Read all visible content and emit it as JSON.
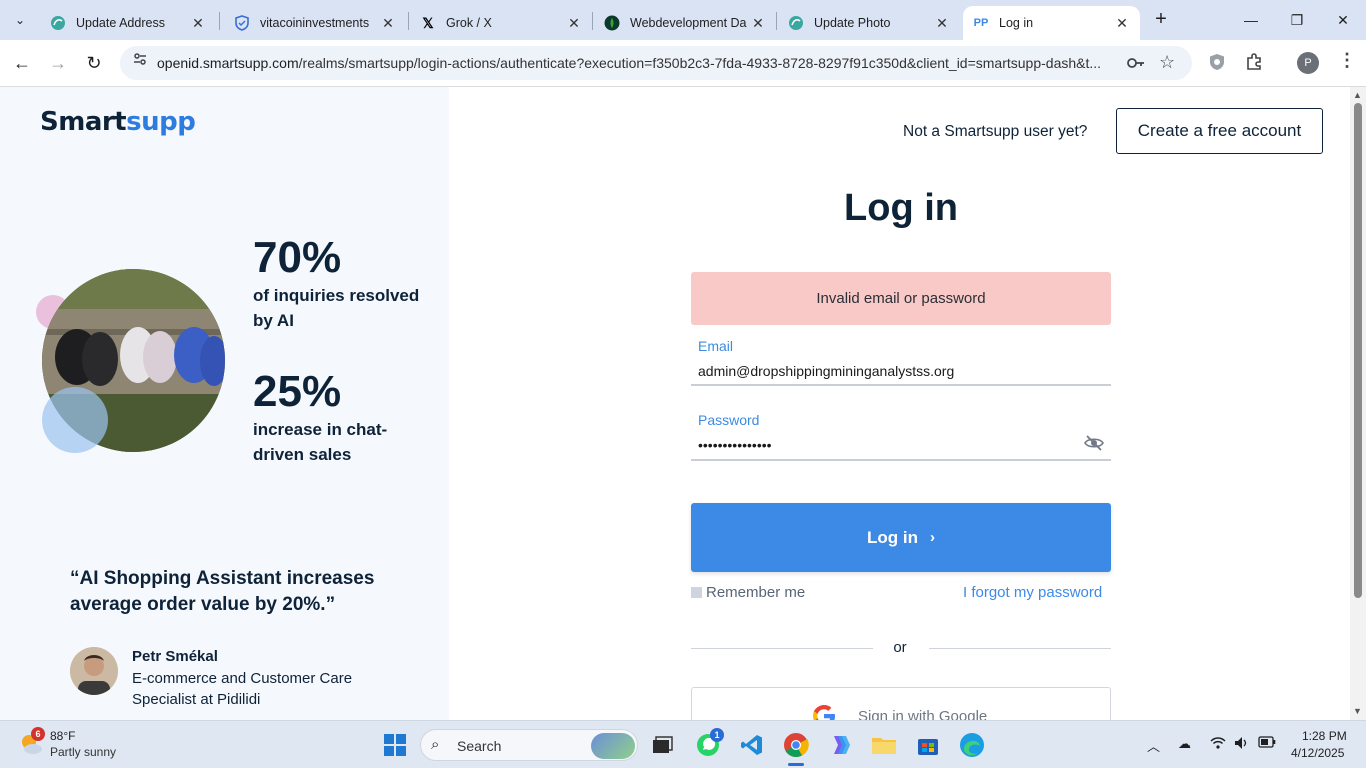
{
  "browser": {
    "tabs": [
      {
        "title": "Update Address",
        "icon": "leaf-favicon"
      },
      {
        "title": "vitacoininvestments",
        "icon": "shield-favicon"
      },
      {
        "title": "Grok / X",
        "icon": "x-favicon"
      },
      {
        "title": "Webdevelopment Da",
        "icon": "mongodb-favicon"
      },
      {
        "title": "Update Photo",
        "icon": "leaf-favicon"
      },
      {
        "title": "Log in",
        "icon": "smartsupp-favicon",
        "active": true
      }
    ],
    "url_host": "openid.smartsupp.com",
    "url_rest": "/realms/smartsupp/login-actions/authenticate?execution=f350b2c3-7fda-4933-8728-8297f91c350d&client_id=smartsupp-dash&t...",
    "profile_initial": "P"
  },
  "left": {
    "logo_part1": "Smart",
    "logo_part2": "supp",
    "stat1_value": "70%",
    "stat1_label": "of inquiries resolved by AI",
    "stat2_value": "25%",
    "stat2_label": "increase in chat-driven sales",
    "quote": "“AI Shopping Assistant increases average order value by 20%.”",
    "person_name": "Petr Smékal",
    "person_role": "E-commerce and Customer Care Specialist at Pidilidi"
  },
  "header": {
    "not_user": "Not a Smartsupp user yet?",
    "create_account": "Create a free account"
  },
  "form": {
    "title": "Log in",
    "error": "Invalid email or password",
    "email_label": "Email",
    "email_value": "admin@dropshippingmininganalystss.org",
    "password_label": "Password",
    "password_value": "•••••••••••••••",
    "login_button": "Log in",
    "remember_me": "Remember me",
    "forgot": "I forgot my password",
    "or": "or",
    "google": "Sign in with Google"
  },
  "taskbar": {
    "weather_badge": "6",
    "temperature": "88°F",
    "condition": "Partly sunny",
    "search_label": "Search",
    "whatsapp_badge": "1",
    "time": "1:28 PM",
    "date": "4/12/2025"
  },
  "colors": {
    "accent": "#3d8ae6",
    "error_bg": "#f9c9c7",
    "text_dark": "#0e2238",
    "left_panel_bg": "#f5f9fd"
  }
}
